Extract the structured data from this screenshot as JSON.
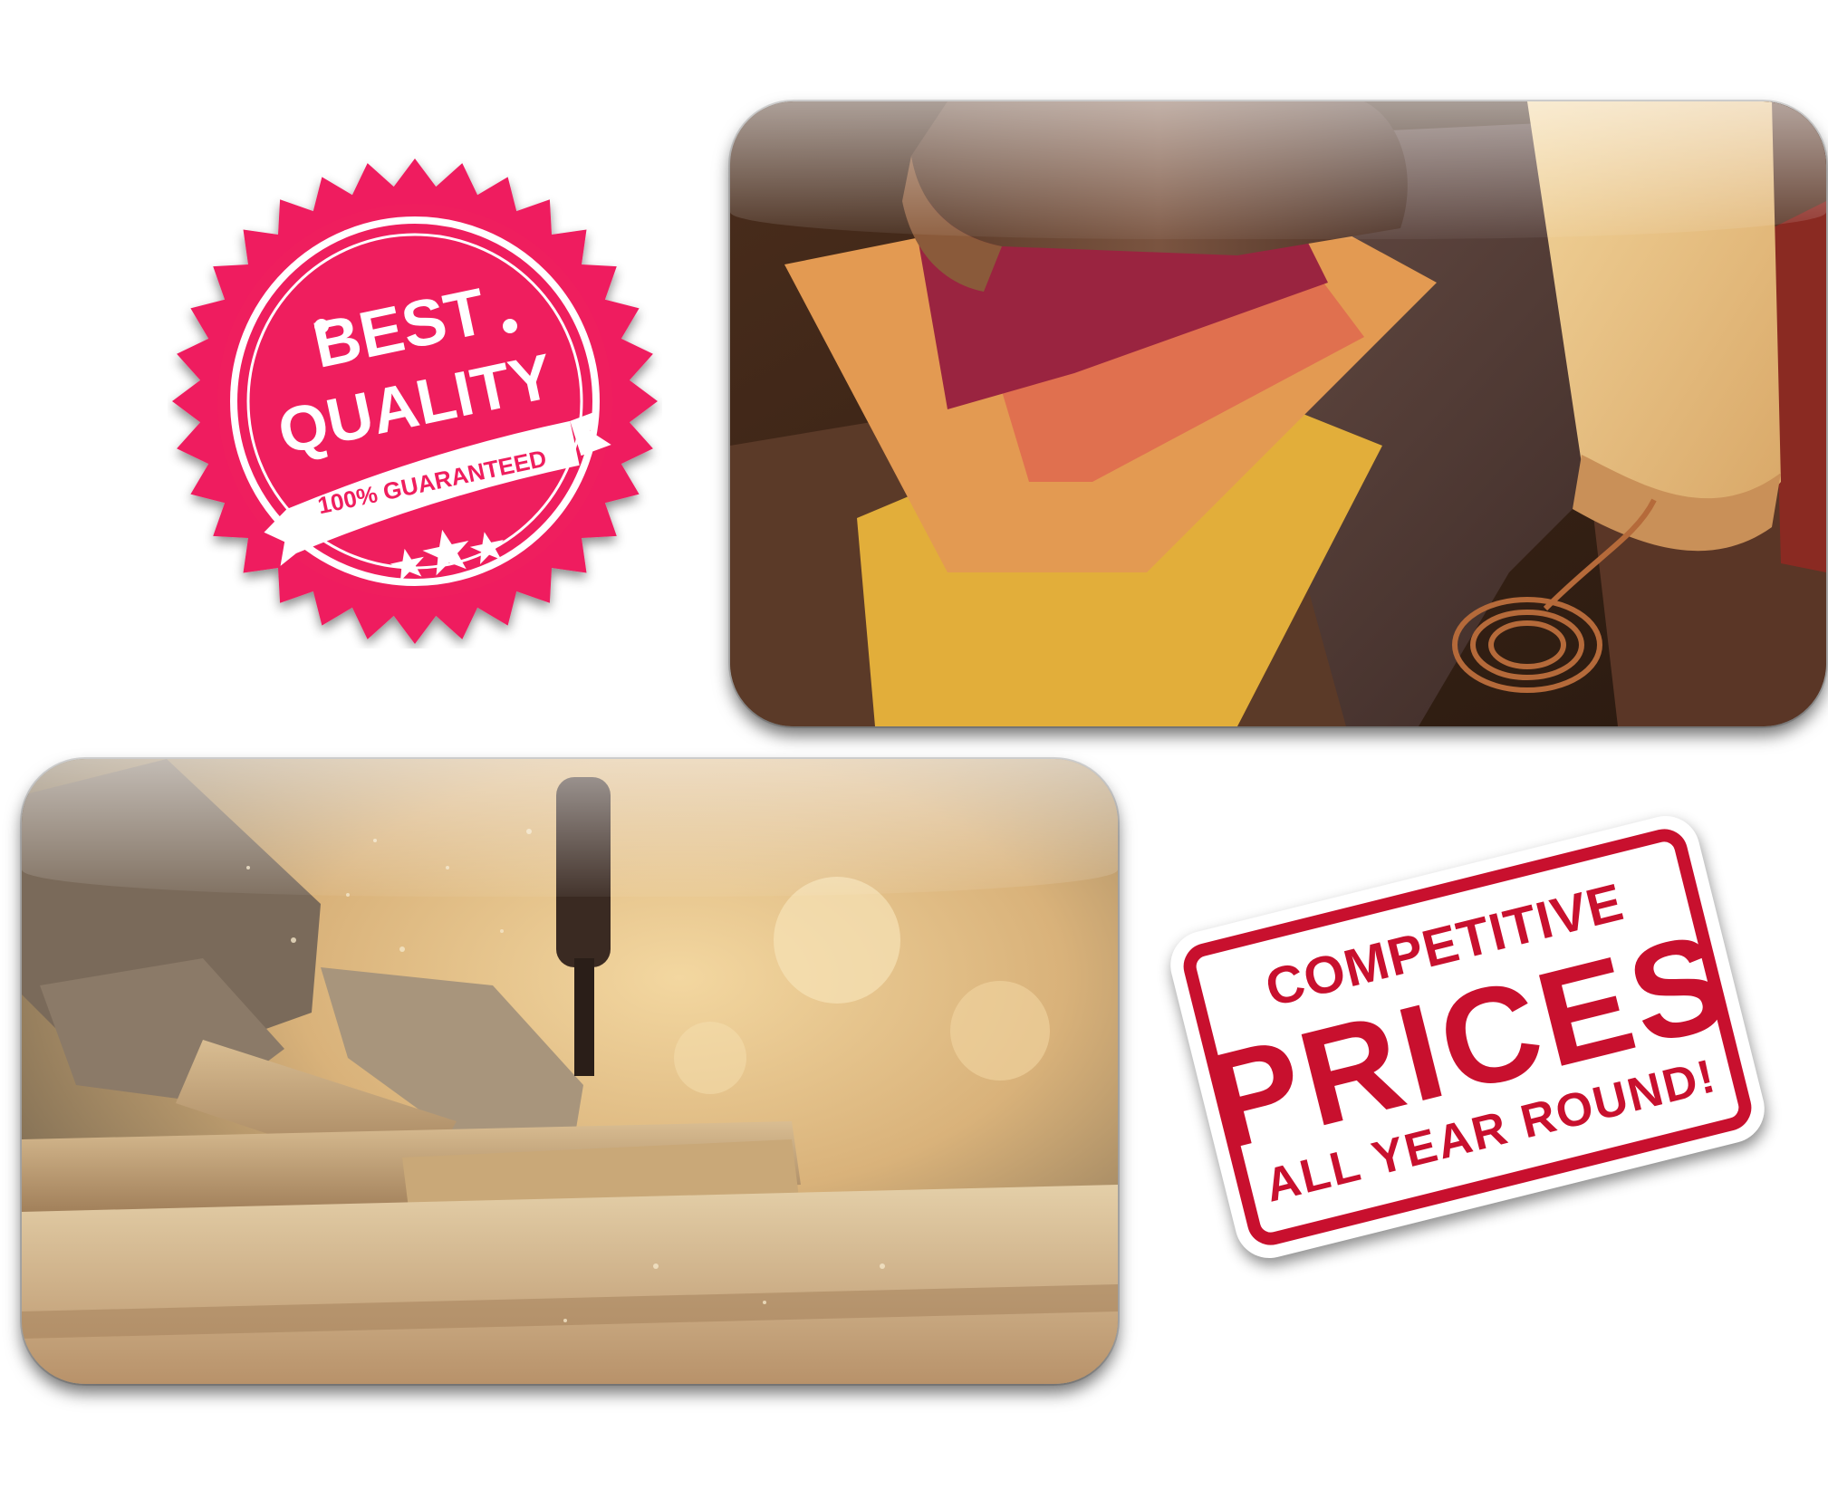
{
  "seal": {
    "line1": "BEST",
    "line2": "QUALITY",
    "ribbon": "100% GUARANTEED",
    "color": "#ef1e5e"
  },
  "stamp": {
    "line1": "COMPETITIVE",
    "line2": "PRICES",
    "line3": "ALL YEAR ROUND!",
    "color": "#c8102e"
  },
  "photos": {
    "top": "leather-swatches-photo",
    "bottom": "woodworking-saw-photo"
  }
}
